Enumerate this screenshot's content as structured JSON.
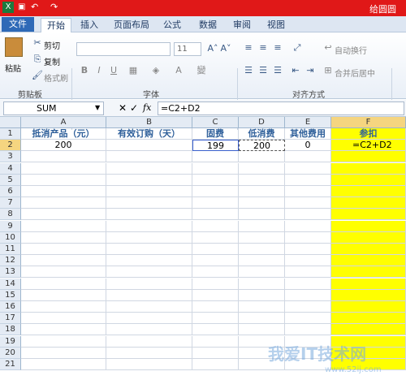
{
  "window": {
    "title": "给圆圆"
  },
  "tabs": {
    "file": "文件",
    "items": [
      "开始",
      "插入",
      "页面布局",
      "公式",
      "数据",
      "审阅",
      "视图"
    ]
  },
  "ribbon": {
    "paste": "粘贴",
    "cut": "剪切",
    "copy": "复制",
    "format_painter": "格式刷",
    "clipboard_group": "剪贴板",
    "font_size": "11",
    "font_group": "字体",
    "wrap_text": "自动换行",
    "merge_center": "合并后居中",
    "align_group": "对齐方式"
  },
  "formula_bar": {
    "name_box": "SUM",
    "fx": "fx",
    "formula": "=C2+D2"
  },
  "columns": [
    "A",
    "B",
    "C",
    "D",
    "E",
    "F"
  ],
  "rows": [
    "1",
    "2",
    "3",
    "4",
    "5",
    "6",
    "7",
    "8",
    "9",
    "10",
    "11",
    "12",
    "13",
    "14",
    "15",
    "16",
    "17",
    "18",
    "19",
    "20",
    "21"
  ],
  "sheet": {
    "headers": [
      "抵消产品（元）",
      "有效订购（天）",
      "固费",
      "低消费",
      "其他费用",
      "参扣"
    ],
    "row2": [
      "200",
      "",
      "199",
      "200",
      "0",
      "=C2+D2"
    ]
  },
  "watermark": {
    "text": "我爱IT技术网",
    "sub": "www.52ij.com"
  }
}
